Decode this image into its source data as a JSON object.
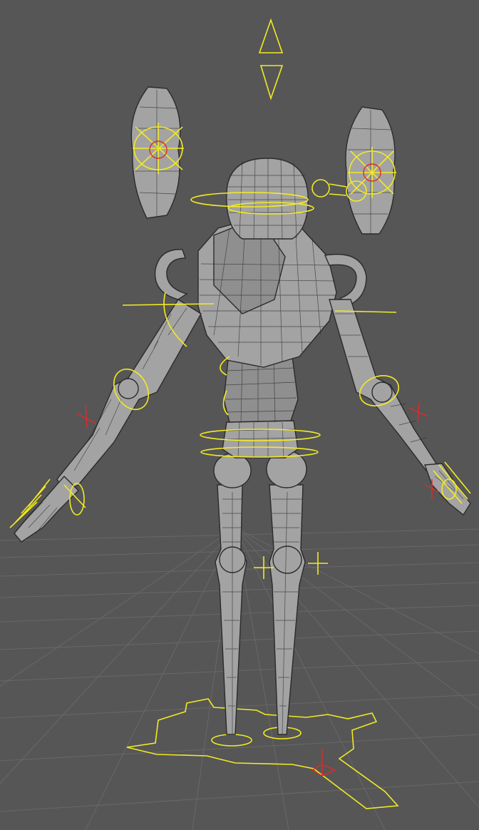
{
  "viewport": {
    "label": "",
    "background_color": "#565656",
    "grid_color": "#686868",
    "mesh_fill_color": "#a3a3a3",
    "wireframe_color": "#2b2b2b",
    "rig_control_color": "#f2ea24",
    "joint_marker_color": "#e02a2a"
  },
  "scene": {
    "model": "robot-character-wireframe-mesh",
    "rig": "yellow-animation-controls"
  }
}
